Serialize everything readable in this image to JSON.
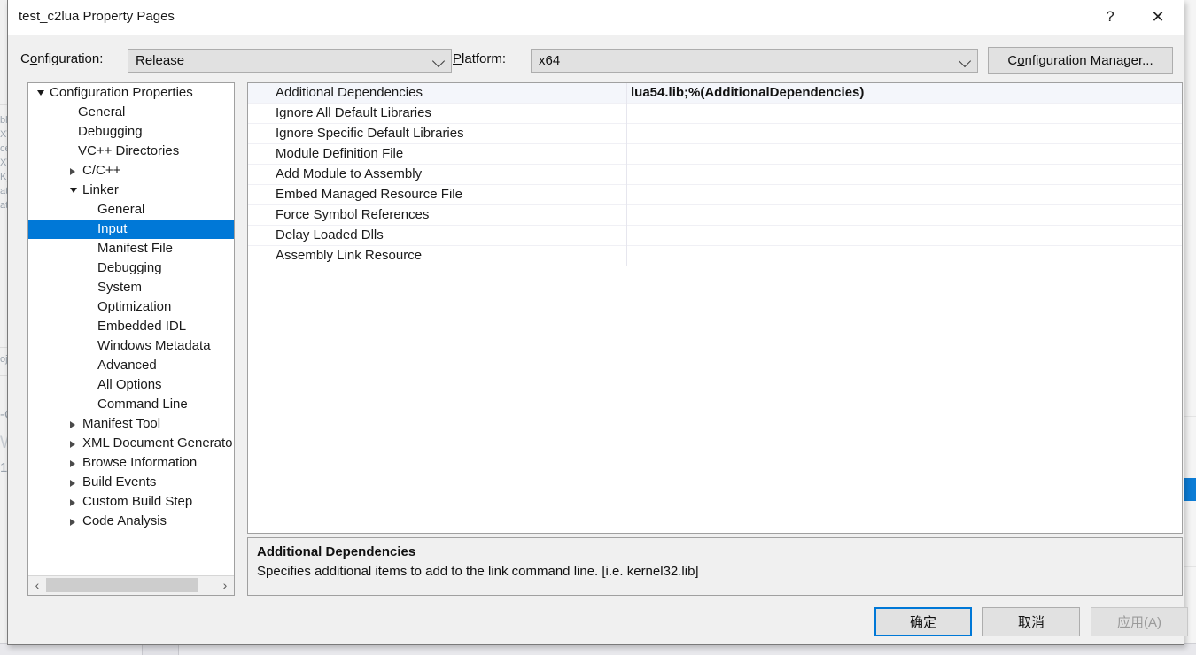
{
  "window": {
    "title": "test_c2lua Property Pages",
    "help_icon": "?",
    "close_icon": "✕"
  },
  "config_row": {
    "configuration_label_pre": "C",
    "configuration_label_accel": "o",
    "configuration_label_post": "nfiguration:",
    "configuration_value": "Release",
    "platform_label_pre": "",
    "platform_label_accel": "P",
    "platform_label_post": "latform:",
    "platform_value": "x64",
    "config_manager_pre": "C",
    "config_manager_accel": "o",
    "config_manager_post": "nfiguration Manager..."
  },
  "tree": {
    "items": [
      {
        "label": "Configuration Properties",
        "indent": 8,
        "arrow": "expanded",
        "selected": false
      },
      {
        "label": "General",
        "indent": 40,
        "arrow": "none",
        "selected": false
      },
      {
        "label": "Debugging",
        "indent": 40,
        "arrow": "none",
        "selected": false
      },
      {
        "label": "VC++ Directories",
        "indent": 40,
        "arrow": "none",
        "selected": false
      },
      {
        "label": "C/C++",
        "indent": 45,
        "arrow": "collapsed",
        "selected": false
      },
      {
        "label": "Linker",
        "indent": 45,
        "arrow": "expanded",
        "selected": false
      },
      {
        "label": "General",
        "indent": 62,
        "arrow": "none",
        "selected": false
      },
      {
        "label": "Input",
        "indent": 62,
        "arrow": "none",
        "selected": true
      },
      {
        "label": "Manifest File",
        "indent": 62,
        "arrow": "none",
        "selected": false
      },
      {
        "label": "Debugging",
        "indent": 62,
        "arrow": "none",
        "selected": false
      },
      {
        "label": "System",
        "indent": 62,
        "arrow": "none",
        "selected": false
      },
      {
        "label": "Optimization",
        "indent": 62,
        "arrow": "none",
        "selected": false
      },
      {
        "label": "Embedded IDL",
        "indent": 62,
        "arrow": "none",
        "selected": false
      },
      {
        "label": "Windows Metadata",
        "indent": 62,
        "arrow": "none",
        "selected": false
      },
      {
        "label": "Advanced",
        "indent": 62,
        "arrow": "none",
        "selected": false
      },
      {
        "label": "All Options",
        "indent": 62,
        "arrow": "none",
        "selected": false
      },
      {
        "label": "Command Line",
        "indent": 62,
        "arrow": "none",
        "selected": false
      },
      {
        "label": "Manifest Tool",
        "indent": 45,
        "arrow": "collapsed",
        "selected": false
      },
      {
        "label": "XML Document Generato",
        "indent": 45,
        "arrow": "collapsed",
        "selected": false
      },
      {
        "label": "Browse Information",
        "indent": 45,
        "arrow": "collapsed",
        "selected": false
      },
      {
        "label": "Build Events",
        "indent": 45,
        "arrow": "collapsed",
        "selected": false
      },
      {
        "label": "Custom Build Step",
        "indent": 45,
        "arrow": "collapsed",
        "selected": false
      },
      {
        "label": "Code Analysis",
        "indent": 45,
        "arrow": "collapsed",
        "selected": false
      }
    ],
    "hscroll": {
      "left_icon": "‹",
      "right_icon": "›"
    }
  },
  "grid": {
    "rows": [
      {
        "name": "Additional Dependencies",
        "value": "lua54.lib;%(AdditionalDependencies)",
        "selected": true
      },
      {
        "name": "Ignore All Default Libraries",
        "value": "",
        "selected": false
      },
      {
        "name": "Ignore Specific Default Libraries",
        "value": "",
        "selected": false
      },
      {
        "name": "Module Definition File",
        "value": "",
        "selected": false
      },
      {
        "name": "Add Module to Assembly",
        "value": "",
        "selected": false
      },
      {
        "name": "Embed Managed Resource File",
        "value": "",
        "selected": false
      },
      {
        "name": "Force Symbol References",
        "value": "",
        "selected": false
      },
      {
        "name": "Delay Loaded Dlls",
        "value": "",
        "selected": false
      },
      {
        "name": "Assembly Link Resource",
        "value": "",
        "selected": false
      }
    ]
  },
  "description": {
    "title": "Additional Dependencies",
    "body": "Specifies additional items to add to the link command line. [i.e. kernel32.lib]"
  },
  "buttons": {
    "ok": "确定",
    "cancel": "取消",
    "apply_pre": "应用(",
    "apply_accel": "A",
    "apply_post": ")"
  },
  "colors": {
    "selection_blue": "#0078d7",
    "dialog_face": "#f0f0f0",
    "grid_row_selected": "#f4f6fb"
  }
}
